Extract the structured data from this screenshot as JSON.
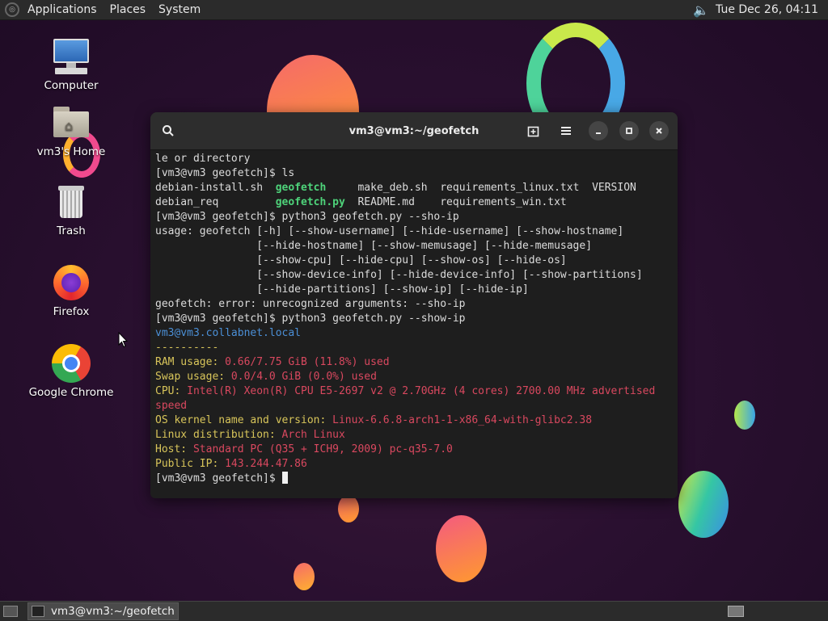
{
  "top_panel": {
    "menu": [
      "Applications",
      "Places",
      "System"
    ],
    "clock": "Tue Dec 26, 04:11"
  },
  "desktop_icons": [
    {
      "label": "Computer",
      "icon": "computer-icon"
    },
    {
      "label": "vm3's Home",
      "icon": "home-folder-icon"
    },
    {
      "label": "Trash",
      "icon": "trash-icon"
    },
    {
      "label": "Firefox",
      "icon": "firefox-icon"
    },
    {
      "label": "Google Chrome",
      "icon": "chrome-icon"
    }
  ],
  "terminal": {
    "title": "vm3@vm3:~/geofetch",
    "lines": {
      "l0": "le or directory",
      "l1": "[vm3@vm3 geofetch]$ ls",
      "l2a": "debian-install.sh  ",
      "l2b": "geofetch",
      "l2c": "     make_deb.sh  requirements_linux.txt  VERSION",
      "l3a": "debian_req         ",
      "l3b": "geofetch.py",
      "l3c": "  README.md    requirements_win.txt",
      "l4": "[vm3@vm3 geofetch]$ python3 geofetch.py --sho-ip",
      "l5": "usage: geofetch [-h] [--show-username] [--hide-username] [--show-hostname]",
      "l6": "                [--hide-hostname] [--show-memusage] [--hide-memusage]",
      "l7": "                [--show-cpu] [--hide-cpu] [--show-os] [--hide-os]",
      "l8": "                [--show-device-info] [--hide-device-info] [--show-partitions]",
      "l9": "                [--hide-partitions] [--show-ip] [--hide-ip]",
      "l10": "geofetch: error: unrecognized arguments: --sho-ip",
      "l11": "[vm3@vm3 geofetch]$ python3 geofetch.py --show-ip",
      "l12": "vm3@vm3.collabnet.local",
      "l13": "----------",
      "l14a": "RAM usage: ",
      "l14b": "0.66/7.75 GiB (11.8%) used",
      "l15a": "Swap usage: ",
      "l15b": "0.0/4.0 GiB (0.0%) used",
      "l16a": "CPU: ",
      "l16b": "Intel(R) Xeon(R) CPU E5-2697 v2 @ 2.70GHz (4 cores) 2700.00 MHz advertised",
      "l17": "speed",
      "l18a": "OS kernel name and version: ",
      "l18b": "Linux-6.6.8-arch1-1-x86_64-with-glibc2.38",
      "l19a": "Linux distribution: ",
      "l19b": "Arch Linux",
      "l20a": "Host: ",
      "l20b": "Standard PC (Q35 + ICH9, 2009) pc-q35-7.0",
      "l21a": "Public IP: ",
      "l21b": "143.244.47.86",
      "l22": "",
      "l23": "[vm3@vm3 geofetch]$ "
    }
  },
  "taskbar": {
    "window_label": "vm3@vm3:~/geofetch"
  },
  "colors": {
    "ls_executable": "#4ed37a",
    "info_label": "#d8c55a",
    "info_value": "#d9485f",
    "hostname": "#4b8fd6"
  }
}
